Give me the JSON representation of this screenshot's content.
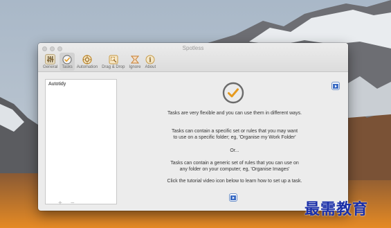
{
  "window": {
    "title": "Spotless"
  },
  "toolbar": {
    "items": [
      {
        "label": "General",
        "icon": "sliders-icon",
        "active": false
      },
      {
        "label": "Tasks",
        "icon": "checkmark-icon",
        "active": true
      },
      {
        "label": "Automation",
        "icon": "automation-icon",
        "active": false
      },
      {
        "label": "Drag & Drop",
        "icon": "drag-drop-icon",
        "active": false
      },
      {
        "label": "Ignore",
        "icon": "ignore-icon",
        "active": false
      },
      {
        "label": "About",
        "icon": "info-icon",
        "active": false
      }
    ]
  },
  "task_list": {
    "items": [
      "Autotidy"
    ],
    "add_label": "+",
    "remove_label": "−"
  },
  "main": {
    "para1": "Tasks are very flexible and you can use them in different ways.",
    "para2_line1": "Tasks can contain a specific set or rules that you may want",
    "para2_line2": "to use on a specific folder; eg, 'Organise my Work Folder'",
    "para3": "Or...",
    "para4_line1": "Tasks can contain a generic set of rules that you can use on",
    "para4_line2": "any folder on your computer; eg, 'Organise Images'",
    "para5": "Click the tutorial video icon below to learn how to set up a task."
  },
  "watermark": {
    "text": "最需教育"
  },
  "colors": {
    "accent_orange": "#e69a1e",
    "check_circle": "#6b6b6b",
    "video_blue": "#3a6bc4"
  }
}
